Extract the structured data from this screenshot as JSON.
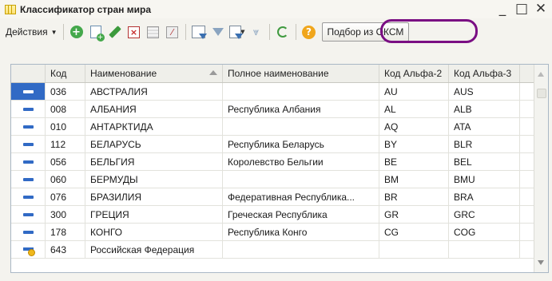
{
  "window": {
    "title": "Классификатор стран мира",
    "minimize_glyph": "_",
    "maximize_glyph": "□",
    "close_glyph": "✕"
  },
  "toolbar": {
    "actions_label": "Действия",
    "help_glyph": "?",
    "pick_label": "Подбор из ОКСМ",
    "highlight_color": "#7a0e83"
  },
  "table": {
    "headers": [
      "Код",
      "Наименование",
      "Полное наименование",
      "Код Альфа-2",
      "Код Альфа-3"
    ],
    "sorted_column": "Наименование",
    "rows": [
      {
        "code": "036",
        "name": "АВСТРАЛИЯ",
        "full": "",
        "a2": "AU",
        "a3": "AUS",
        "selected": true,
        "icon": "item-dash-icon"
      },
      {
        "code": "008",
        "name": "АЛБАНИЯ",
        "full": "Республика Албания",
        "a2": "AL",
        "a3": "ALB",
        "icon": "item-dash-icon"
      },
      {
        "code": "010",
        "name": "АНТАРКТИДА",
        "full": "",
        "a2": "AQ",
        "a3": "ATA",
        "icon": "item-dash-icon"
      },
      {
        "code": "112",
        "name": "БЕЛАРУСЬ",
        "full": "Республика Беларусь",
        "a2": "BY",
        "a3": "BLR",
        "icon": "item-dash-icon"
      },
      {
        "code": "056",
        "name": "БЕЛЬГИЯ",
        "full": "Королевство Бельгии",
        "a2": "BE",
        "a3": "BEL",
        "icon": "item-dash-icon"
      },
      {
        "code": "060",
        "name": "БЕРМУДЫ",
        "full": "",
        "a2": "BM",
        "a3": "BMU",
        "icon": "item-dash-icon"
      },
      {
        "code": "076",
        "name": "БРАЗИЛИЯ",
        "full": "Федеративная Республика...",
        "a2": "BR",
        "a3": "BRA",
        "icon": "item-dash-icon"
      },
      {
        "code": "300",
        "name": "ГРЕЦИЯ",
        "full": "Греческая Республика",
        "a2": "GR",
        "a3": "GRC",
        "icon": "item-dash-icon"
      },
      {
        "code": "178",
        "name": "КОНГО",
        "full": "Республика Конго",
        "a2": "CG",
        "a3": "COG",
        "icon": "item-dash-icon"
      },
      {
        "code": "643",
        "name": "Российская Федерация",
        "full": "",
        "a2": "",
        "a3": "",
        "icon": "item-predefined-icon"
      }
    ]
  },
  "colors": {
    "selection": "#316ac5",
    "accent_yellow": "#f0b81c"
  }
}
